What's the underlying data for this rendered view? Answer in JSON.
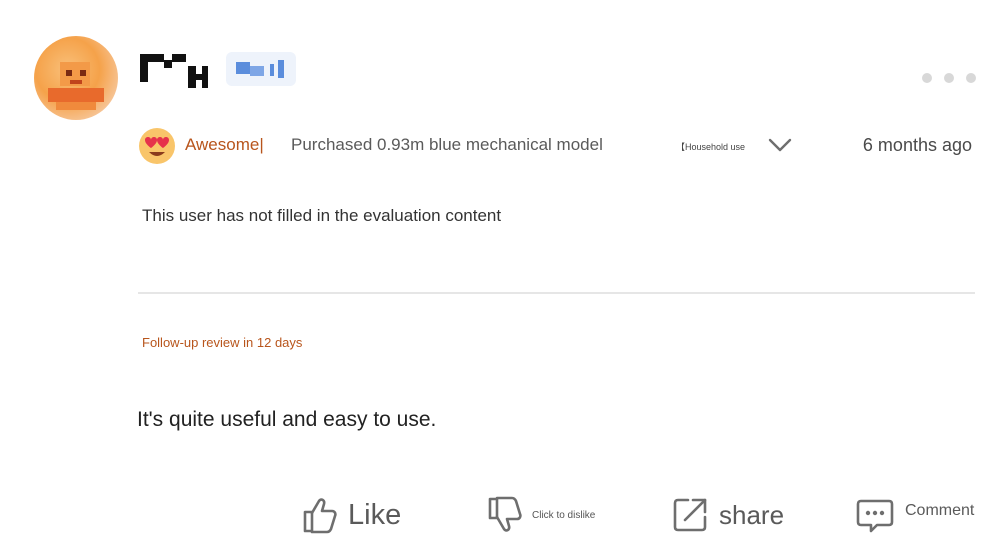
{
  "user": {
    "avatar": "pixelated-orange-avatar",
    "name_redacted": true,
    "badge_redacted": true
  },
  "header": {
    "more_icon": "more-dots-icon"
  },
  "review": {
    "rating_icon": "heart-eyes-emoji-icon",
    "rating_label": "Awesome|",
    "product_spec": "Purchased 0.93m blue mechanical model",
    "usage_tag": "【Household use",
    "expand_icon": "chevron-down-icon",
    "time_ago": "6 months ago",
    "content": "This user has not filled in the evaluation content",
    "followup_label": "Follow-up review in 12 days",
    "followup_content": "It's quite useful and easy to use."
  },
  "actions": {
    "like_label": "Like",
    "dislike_label": "Click to dislike",
    "share_label": "share",
    "comment_label": "Comment"
  },
  "colors": {
    "accent": "#b8551c",
    "icon_gray": "#6e6e6e",
    "divider": "#e6e6e6"
  }
}
